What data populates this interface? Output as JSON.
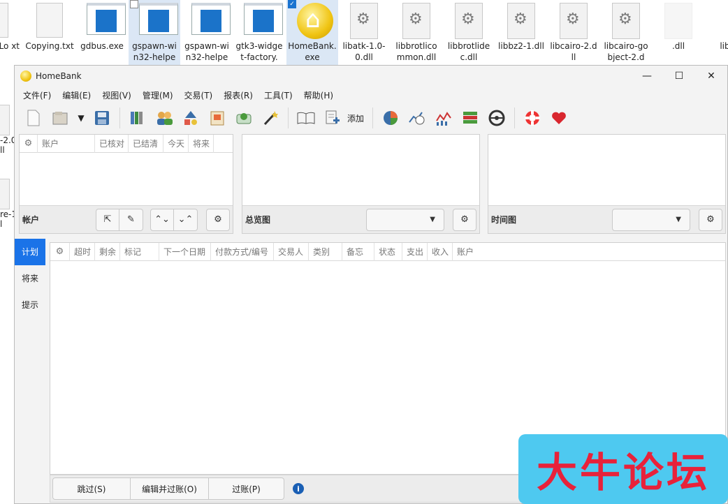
{
  "desktop": {
    "icons": [
      {
        "label": "geLo\nxt",
        "type": "doc"
      },
      {
        "label": "Copying.txt",
        "type": "doc"
      },
      {
        "label": "gdbus.exe",
        "type": "exe"
      },
      {
        "label": "gspawn-win32-helpe",
        "type": "exe"
      },
      {
        "label": "gspawn-win32-helpe",
        "type": "exe"
      },
      {
        "label": "gtk3-widget-factory.",
        "type": "exe"
      },
      {
        "label": "HomeBank.exe",
        "type": "home"
      },
      {
        "label": "libatk-1.0-0.dll",
        "type": "dll"
      },
      {
        "label": "libbrotlicommon.dll",
        "type": "dll"
      },
      {
        "label": "libbrotlidec.dll",
        "type": "dll"
      },
      {
        "label": "libbz2-1.dll",
        "type": "dll"
      },
      {
        "label": "libcairo-2.dll",
        "type": "dll"
      },
      {
        "label": "libcairo-gobject-2.d",
        "type": "dll"
      },
      {
        "label": ".dll",
        "type": "dll"
      },
      {
        "label": "libep",
        "type": "dll"
      }
    ],
    "side_labels": [
      "-2.0\nll",
      "re-1\nl"
    ]
  },
  "window": {
    "title": "HomeBank",
    "min": "—",
    "max": "☐",
    "close": "✕"
  },
  "menu": [
    "文件(F)",
    "编辑(E)",
    "视图(V)",
    "管理(M)",
    "交易(T)",
    "报表(R)",
    "工具(T)",
    "帮助(H)"
  ],
  "toolbar": {
    "add_label": "添加"
  },
  "accounts_pane": {
    "columns": [
      "账户",
      "已核对",
      "已结清",
      "今天",
      "将来"
    ],
    "footer_label": "帐户"
  },
  "overview_pane": {
    "footer_label": "总览图"
  },
  "timeline_pane": {
    "footer_label": "时间图"
  },
  "tabs": [
    "计划",
    "将来",
    "提示"
  ],
  "schedule": {
    "columns": [
      "超时",
      "剩余",
      "标记",
      "下一个日期",
      "付款方式/编号",
      "交易人",
      "类别",
      "备忘",
      "状态",
      "支出",
      "收入",
      "账户"
    ]
  },
  "bottom": {
    "skip": "跳过(S)",
    "edit_post": "编辑并过账(O)",
    "post": "过账(P)"
  },
  "watermark": "大牛论坛"
}
